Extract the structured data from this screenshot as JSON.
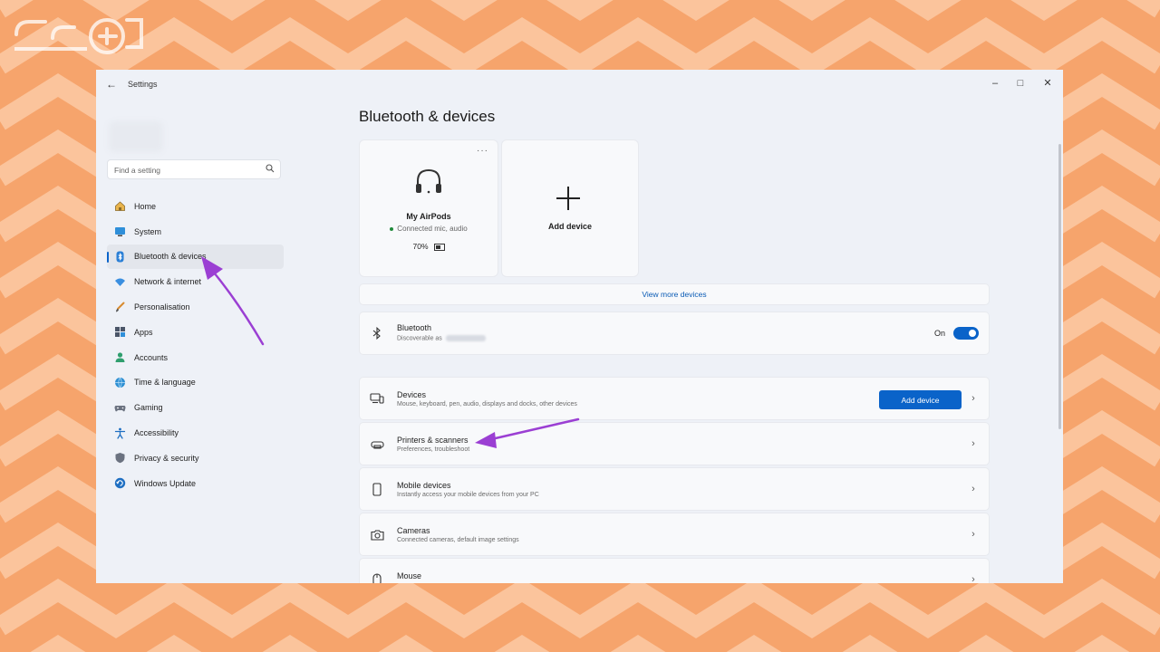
{
  "window": {
    "title": "Settings"
  },
  "search": {
    "placeholder": "Find a setting"
  },
  "sidebar": {
    "items": [
      {
        "label": "Home",
        "icon": "home-icon"
      },
      {
        "label": "System",
        "icon": "system-icon"
      },
      {
        "label": "Bluetooth & devices",
        "icon": "bluetooth-icon",
        "active": true
      },
      {
        "label": "Network & internet",
        "icon": "wifi-icon"
      },
      {
        "label": "Personalisation",
        "icon": "brush-icon"
      },
      {
        "label": "Apps",
        "icon": "apps-icon"
      },
      {
        "label": "Accounts",
        "icon": "accounts-icon"
      },
      {
        "label": "Time & language",
        "icon": "globe-clock-icon"
      },
      {
        "label": "Gaming",
        "icon": "gamepad-icon"
      },
      {
        "label": "Accessibility",
        "icon": "accessibility-icon"
      },
      {
        "label": "Privacy & security",
        "icon": "shield-icon"
      },
      {
        "label": "Windows Update",
        "icon": "update-icon"
      }
    ]
  },
  "main": {
    "title": "Bluetooth & devices",
    "device_card": {
      "name": "My AirPods",
      "status": "Connected mic, audio",
      "battery": "70%",
      "icon": "headphones-icon"
    },
    "add_card": {
      "label": "Add device",
      "icon": "plus-icon"
    },
    "view_more": "View more devices",
    "bluetooth": {
      "title": "Bluetooth",
      "desc": "Discoverable as",
      "toggle_label": "On",
      "toggle_on": true
    },
    "rows": [
      {
        "title": "Devices",
        "desc": "Mouse, keyboard, pen, audio, displays and docks, other devices",
        "button": "Add device",
        "icon": "devices-icon"
      },
      {
        "title": "Printers & scanners",
        "desc": "Preferences, troubleshoot",
        "icon": "printer-icon"
      },
      {
        "title": "Mobile devices",
        "desc": "Instantly access your mobile devices from your PC",
        "icon": "phone-icon"
      },
      {
        "title": "Cameras",
        "desc": "Connected cameras, default image settings",
        "icon": "camera-icon"
      },
      {
        "title": "Mouse",
        "desc": "",
        "icon": "mouse-icon"
      }
    ]
  },
  "colors": {
    "background": "#f6a46c",
    "accent": "#0a63c9",
    "annotation_arrow": "#9b3fd3"
  }
}
